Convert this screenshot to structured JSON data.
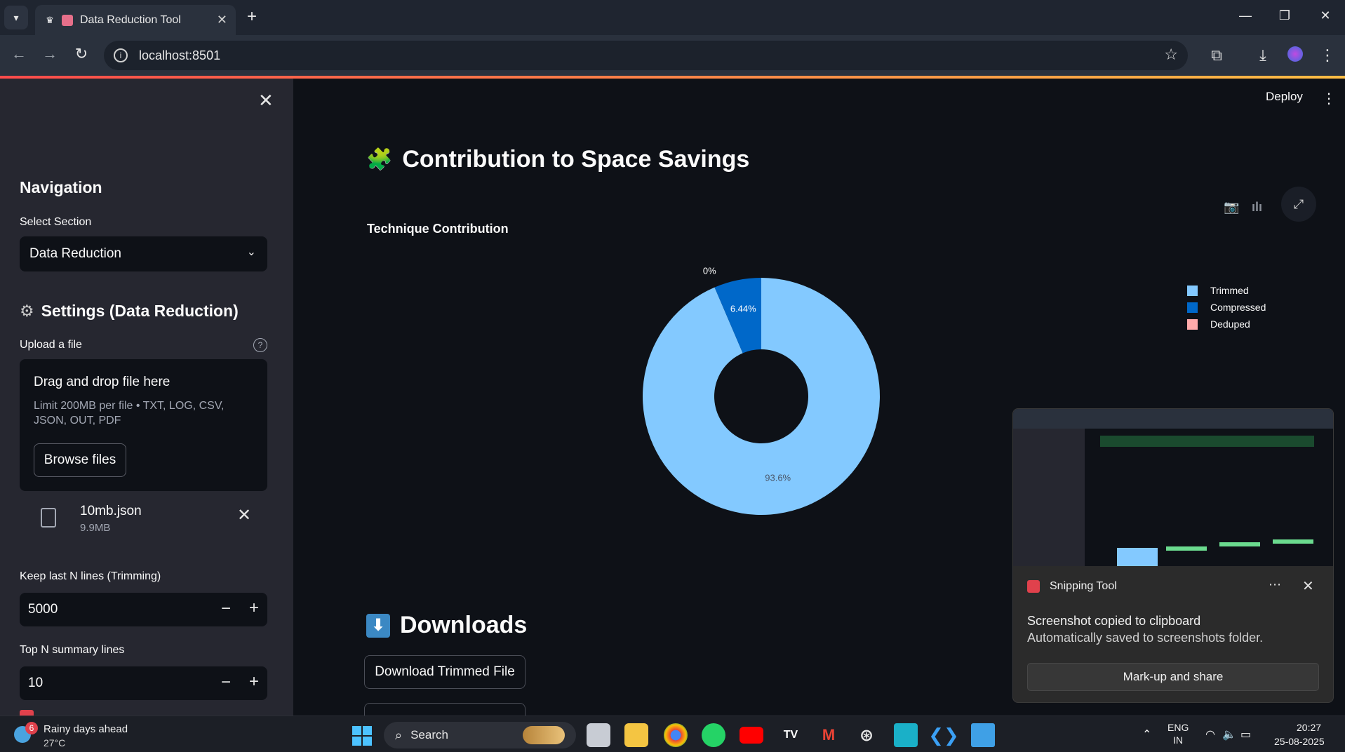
{
  "browser": {
    "tab_title": "Data Reduction Tool",
    "url": "localhost:8501"
  },
  "sidebar": {
    "navigation_heading": "Navigation",
    "select_label": "Select Section",
    "select_value": "Data Reduction",
    "settings_heading": "Settings (Data Reduction)",
    "upload_label": "Upload a file",
    "drop_title": "Drag and drop file here",
    "drop_hint": "Limit 200MB per file • TXT, LOG, CSV, JSON, OUT, PDF",
    "browse_label": "Browse files",
    "file_name": "10mb.json",
    "file_size": "9.9MB",
    "keep_lines_label": "Keep last N lines (Trimming)",
    "keep_lines_value": "5000",
    "topn_label": "Top N summary lines",
    "topn_value": "10"
  },
  "header": {
    "deploy_label": "Deploy"
  },
  "main": {
    "contribution_heading": "Contribution to Space Savings",
    "downloads_heading": "Downloads",
    "download_trimmed_label": "Download Trimmed File"
  },
  "chart_data": {
    "type": "pie",
    "subtype": "donut",
    "title": "Technique Contribution",
    "categories": [
      "Trimmed",
      "Compressed",
      "Deduped"
    ],
    "values": [
      93.6,
      6.44,
      0
    ],
    "labels": [
      "93.6%",
      "6.44%",
      "0%"
    ],
    "colors": [
      "#83c9ff",
      "#0068c9",
      "#ffabab"
    ],
    "legend_position": "right"
  },
  "toast": {
    "app_name": "Snipping Tool",
    "message": "Screenshot copied to clipboard",
    "sub_message": "Automatically saved to screenshots folder.",
    "action_label": "Mark-up and share"
  },
  "taskbar": {
    "weather_badge": "6",
    "weather_text": "Rainy days ahead",
    "temperature": "27°C",
    "search_label": "Search",
    "lang_1": "ENG",
    "lang_2": "IN",
    "time": "20:27",
    "date": "25-08-2025"
  }
}
